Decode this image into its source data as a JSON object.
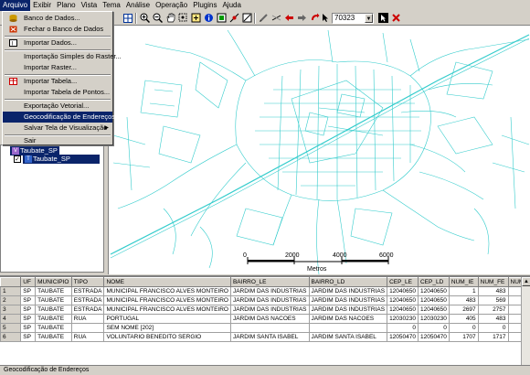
{
  "menubar": {
    "items": [
      "Arquivo",
      "Exibir",
      "Plano",
      "Vista",
      "Tema",
      "Análise",
      "Operação",
      "Plugins",
      "Ajuda"
    ]
  },
  "toolbar": {
    "scale_value": "70323"
  },
  "file_menu": {
    "items": [
      {
        "label": "Banco de Dados...",
        "icon": "database-icon"
      },
      {
        "label": "Fechar o Banco de Dados",
        "icon": "close-database-icon"
      },
      {
        "label": "Importar Dados...",
        "icon": "import-data-icon"
      },
      {
        "label": "Importação Simples do Raster...",
        "icon": ""
      },
      {
        "label": "Importar Raster...",
        "icon": ""
      },
      {
        "label": "Importar Tabela...",
        "icon": "table-icon"
      },
      {
        "label": "Importar Tabela de Pontos...",
        "icon": ""
      },
      {
        "label": "Exportação Vetorial...",
        "icon": ""
      },
      {
        "label": "Geocodificação de Endereços...",
        "icon": ""
      },
      {
        "label": "Salvar Tela de Visualização",
        "icon": ""
      },
      {
        "label": "Sair",
        "icon": ""
      }
    ]
  },
  "left_panel": {
    "partial_labels": [
      "Ba",
      "Vi"
    ],
    "tree": {
      "view_name": "Taubate_SP",
      "theme_name": "Taubate_SP"
    }
  },
  "map": {
    "scale_bar": {
      "ticks": [
        "0",
        "2000",
        "4000",
        "6000"
      ],
      "unit": "Metros"
    },
    "street_color": "#33cccc"
  },
  "table": {
    "columns": [
      "",
      "UF",
      "MUNICIPIO",
      "TIPO",
      "NOME",
      "BAIRRO_LE",
      "BAIRRO_LD",
      "CEP_LE",
      "CEP_LD",
      "NUM_IE",
      "NUM_FE",
      "NUM_"
    ],
    "rows": [
      [
        "1",
        "SP",
        "TAUBATE",
        "ESTRADA",
        "MUNICIPAL FRANCISCO ALVES MONTEIRO",
        "JARDIM DAS INDUSTRIAS",
        "JARDIM DAS INDUSTRIAS",
        "12040650",
        "12040650",
        "1",
        "483",
        ""
      ],
      [
        "2",
        "SP",
        "TAUBATE",
        "ESTRADA",
        "MUNICIPAL FRANCISCO ALVES MONTEIRO",
        "JARDIM DAS INDUSTRIAS",
        "JARDIM DAS INDUSTRIAS",
        "12040650",
        "12040650",
        "483",
        "569",
        ""
      ],
      [
        "3",
        "SP",
        "TAUBATE",
        "ESTRADA",
        "MUNICIPAL FRANCISCO ALVES MONTEIRO",
        "JARDIM DAS INDUSTRIAS",
        "JARDIM DAS INDUSTRIAS",
        "12040650",
        "12040650",
        "2697",
        "2757",
        ""
      ],
      [
        "4",
        "SP",
        "TAUBATE",
        "RUA",
        "PORTUGAL",
        "JARDIM DAS NACOES",
        "JARDIM DAS NACOES",
        "12030230",
        "12030230",
        "405",
        "483",
        ""
      ],
      [
        "5",
        "SP",
        "TAUBATE",
        "",
        "SEM NOME [202]",
        "",
        "",
        "0",
        "0",
        "0",
        "0",
        ""
      ],
      [
        "6",
        "SP",
        "TAUBATE",
        "RUA",
        "VOLUNTARIO BENEDITO SERGIO",
        "JARDIM SANTA ISABEL",
        "JARDIM SANTA ISABEL",
        "12050470",
        "12050470",
        "1707",
        "1717",
        ""
      ]
    ]
  },
  "status_bar": {
    "text": "Geocodificação de Endereços"
  }
}
